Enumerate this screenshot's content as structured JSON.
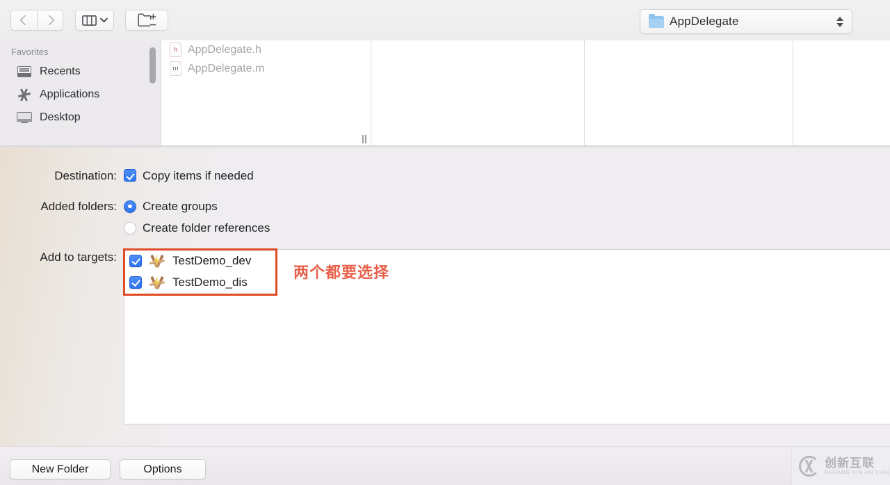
{
  "toolbar": {
    "back_icon": "chevron-left-icon",
    "forward_icon": "chevron-right-icon",
    "view_icon": "column-view-icon",
    "new_folder_icon": "new-folder-icon",
    "path": {
      "label": "AppDelegate",
      "folder_icon": "folder-icon",
      "stepper_icon": "stepper-updown-icon"
    }
  },
  "sidebar": {
    "header": "Favorites",
    "items": [
      {
        "label": "Recents",
        "icon": "recents-icon"
      },
      {
        "label": "Applications",
        "icon": "applications-icon"
      },
      {
        "label": "Desktop",
        "icon": "desktop-icon"
      }
    ]
  },
  "browser": {
    "columns": [
      {
        "files": [
          {
            "name": "AppDelegate.h",
            "badge": "h",
            "icon": "header-file-icon"
          },
          {
            "name": "AppDelegate.m",
            "badge": "m",
            "icon": "objc-file-icon"
          }
        ]
      },
      {
        "files": []
      },
      {
        "files": []
      },
      {
        "files": []
      }
    ]
  },
  "options": {
    "destination": {
      "label": "Destination:",
      "checkbox_label": "Copy items if needed",
      "checked": true
    },
    "added_folders": {
      "label": "Added folders:",
      "choices": [
        {
          "label": "Create groups",
          "selected": true
        },
        {
          "label": "Create folder references",
          "selected": false
        }
      ]
    },
    "add_to_targets": {
      "label": "Add to targets:",
      "targets": [
        {
          "name": "TestDemo_dev",
          "checked": true,
          "icon": "xcode-target-icon"
        },
        {
          "name": "TestDemo_dis",
          "checked": true,
          "icon": "xcode-target-icon"
        }
      ]
    }
  },
  "annotation": {
    "text": "两个都要选择",
    "color": "#e8604a",
    "box_color": "#e04a25"
  },
  "footer": {
    "new_folder_button": "New Folder",
    "options_button": "Options"
  },
  "watermark": {
    "cn": "创新互联",
    "en": "CHUANG XIN HU LIAN",
    "logo_icon": "cx-logo-icon"
  },
  "colors": {
    "accent": "#2f74ef",
    "panel_bg": "#efedef",
    "sidebar_bg": "#eceaec"
  }
}
